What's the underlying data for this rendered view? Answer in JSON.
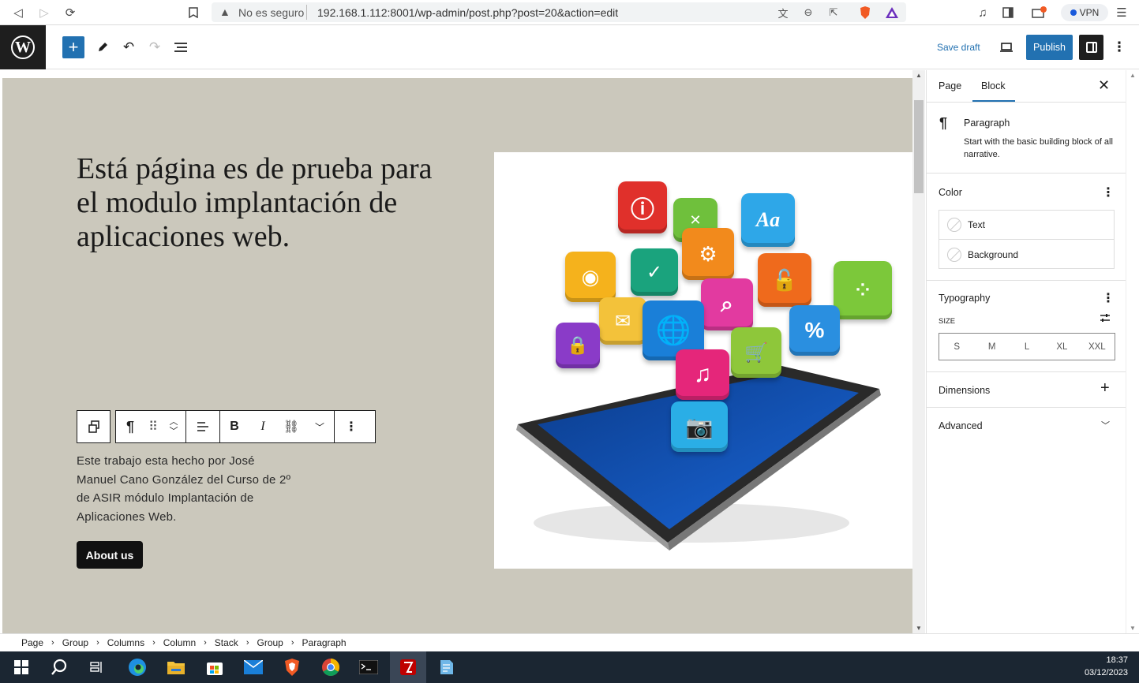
{
  "browser": {
    "security_label": "No es seguro",
    "url": "192.168.1.112:8001/wp-admin/post.php?post=20&action=edit",
    "vpn_label": "VPN"
  },
  "toolbar": {
    "save_draft_label": "Save draft",
    "publish_label": "Publish"
  },
  "content": {
    "heading": "Está página es de prueba para el modulo implantación de aplicaciones web.",
    "paragraph": "Este trabajo esta hecho por José Manuel Cano González del Curso de 2º de ASIR módulo Implantación de Aplicaciones Web.",
    "button_label": "About us"
  },
  "sidebar": {
    "tabs": [
      "Page",
      "Block"
    ],
    "active_tab": "Block",
    "block_name": "Paragraph",
    "block_description": "Start with the basic building block of all narrative.",
    "color_title": "Color",
    "color_items": [
      "Text",
      "Background"
    ],
    "typography_title": "Typography",
    "size_label": "SIZE",
    "size_options": [
      "S",
      "M",
      "L",
      "XL",
      "XXL"
    ],
    "dimensions_title": "Dimensions",
    "advanced_title": "Advanced"
  },
  "breadcrumb": [
    "Page",
    "Group",
    "Columns",
    "Column",
    "Stack",
    "Group",
    "Paragraph"
  ],
  "taskbar": {
    "time": "18:37",
    "date": "03/12/2023"
  },
  "colors": {
    "accent": "#2271b1",
    "canvas_bg": "#cbc8bc",
    "dark": "#1e1e1e"
  }
}
